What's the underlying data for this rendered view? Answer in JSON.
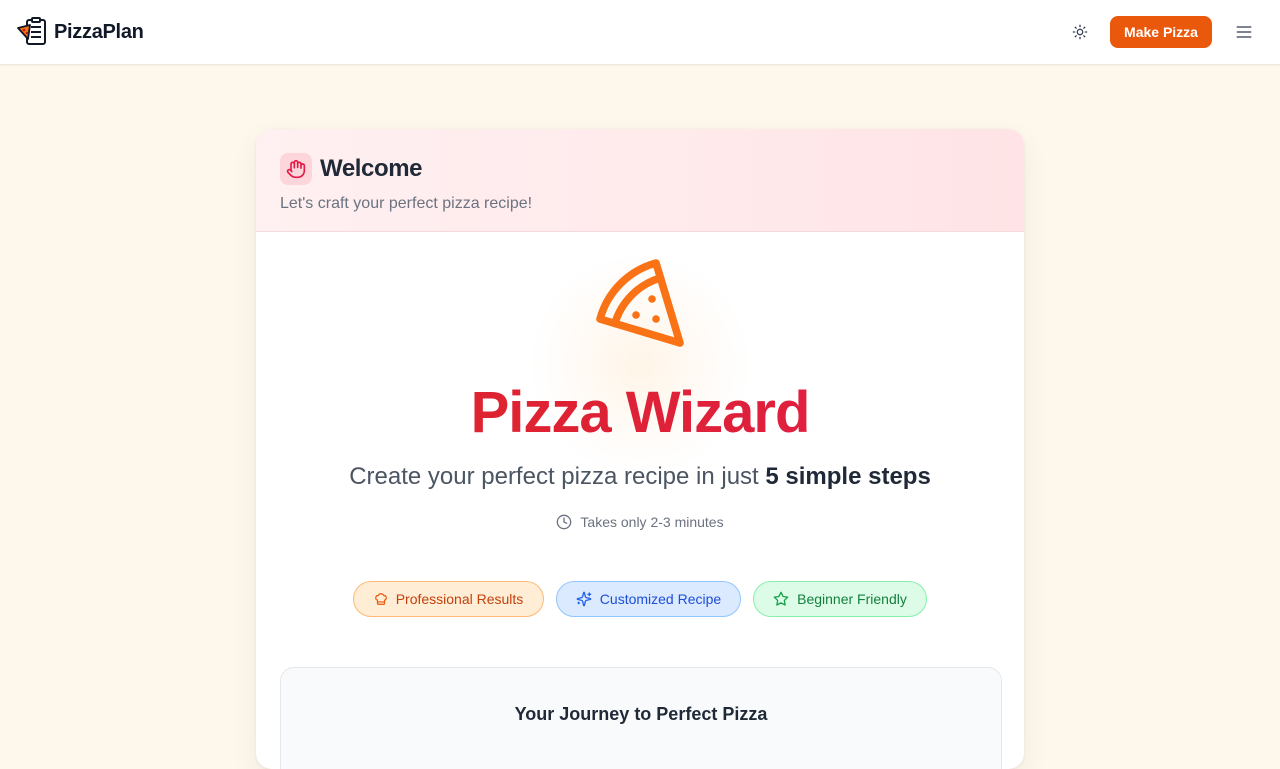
{
  "header": {
    "brand_name": "PizzaPlan",
    "brand_icon": "pizza-checklist-icon",
    "theme_icon": "sun-icon",
    "cta_label": "Make Pizza",
    "menu_icon": "hamburger-menu-icon"
  },
  "card": {
    "header_icon": "wave-hand-icon",
    "title": "Welcome",
    "subtitle": "Let's craft your perfect pizza recipe!"
  },
  "hero": {
    "icon": "pizza-slice-icon",
    "title": "Pizza Wizard",
    "tagline_prefix": "Create your perfect pizza recipe in just",
    "tagline_emphasis": "5 simple steps",
    "duration_icon": "clock-icon",
    "duration": "Takes only 2-3 minutes"
  },
  "badges": [
    {
      "icon": "chef-hat-icon",
      "label": "Professional Results"
    },
    {
      "icon": "sparkles-icon",
      "label": "Customized Recipe"
    },
    {
      "icon": "star-icon",
      "label": "Beginner Friendly"
    }
  ],
  "journey": {
    "title": "Your Journey to Perfect Pizza"
  },
  "colors": {
    "page_bg": "#fef8ec",
    "accent": "#ea580c",
    "title_gradient_start": "#dc2626",
    "title_gradient_end": "#e11d48"
  }
}
